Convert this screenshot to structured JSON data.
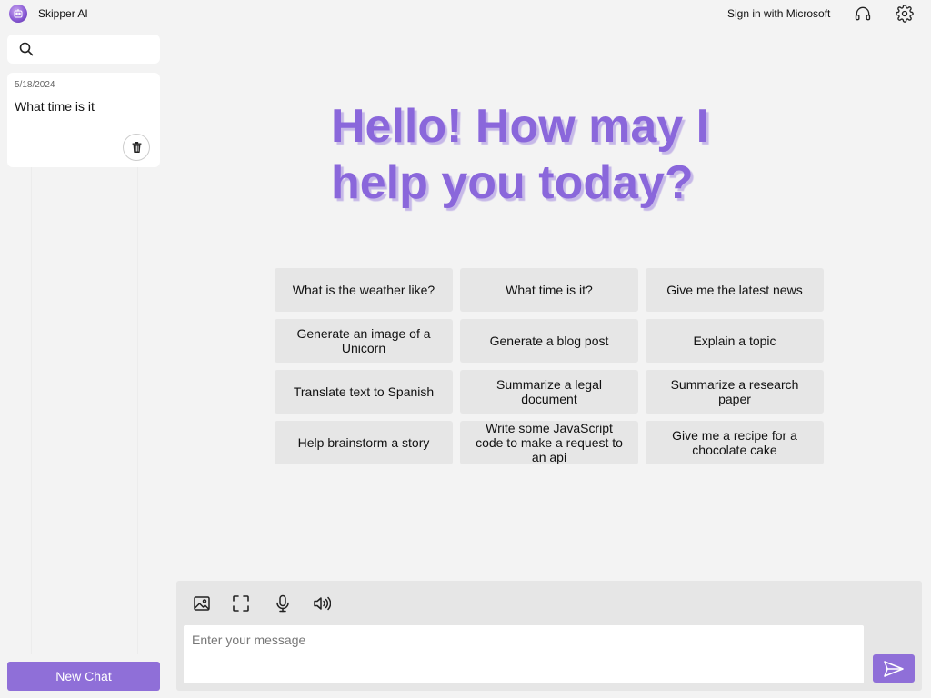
{
  "app": {
    "title": "Skipper AI",
    "logo_icon": "robot-face-icon"
  },
  "header": {
    "signin_label": "Sign in with Microsoft",
    "icons": [
      "headset-icon",
      "gear-icon"
    ]
  },
  "sidebar": {
    "search": {
      "placeholder": "",
      "value": "",
      "icon": "search-icon"
    },
    "chats": [
      {
        "date": "5/18/2024",
        "title": "What time is it",
        "delete_icon": "trash-icon"
      }
    ],
    "new_chat_label": "New Chat"
  },
  "main": {
    "greeting": "Hello! How may I help you today?",
    "suggestions": [
      "What is the weather like?",
      "What time is it?",
      "Give me the latest news",
      "Generate an image of a Unicorn",
      "Generate a blog post",
      "Explain a topic",
      "Translate text to Spanish",
      "Summarize a legal document",
      "Summarize a research paper",
      "Help brainstorm a story",
      "Write some JavaScript code to make a request to an api",
      "Give me a recipe for a chocolate cake"
    ]
  },
  "composer": {
    "placeholder": "Enter your message",
    "value": "",
    "tools": [
      "image-icon",
      "fullscreen-icon",
      "microphone-icon",
      "speaker-icon"
    ],
    "send_icon": "send-icon"
  },
  "colors": {
    "accent": "#8f6fd8",
    "greeting": "#8a67db",
    "background": "#f3f3f3",
    "suggestion_bg": "#e6e6e6"
  }
}
